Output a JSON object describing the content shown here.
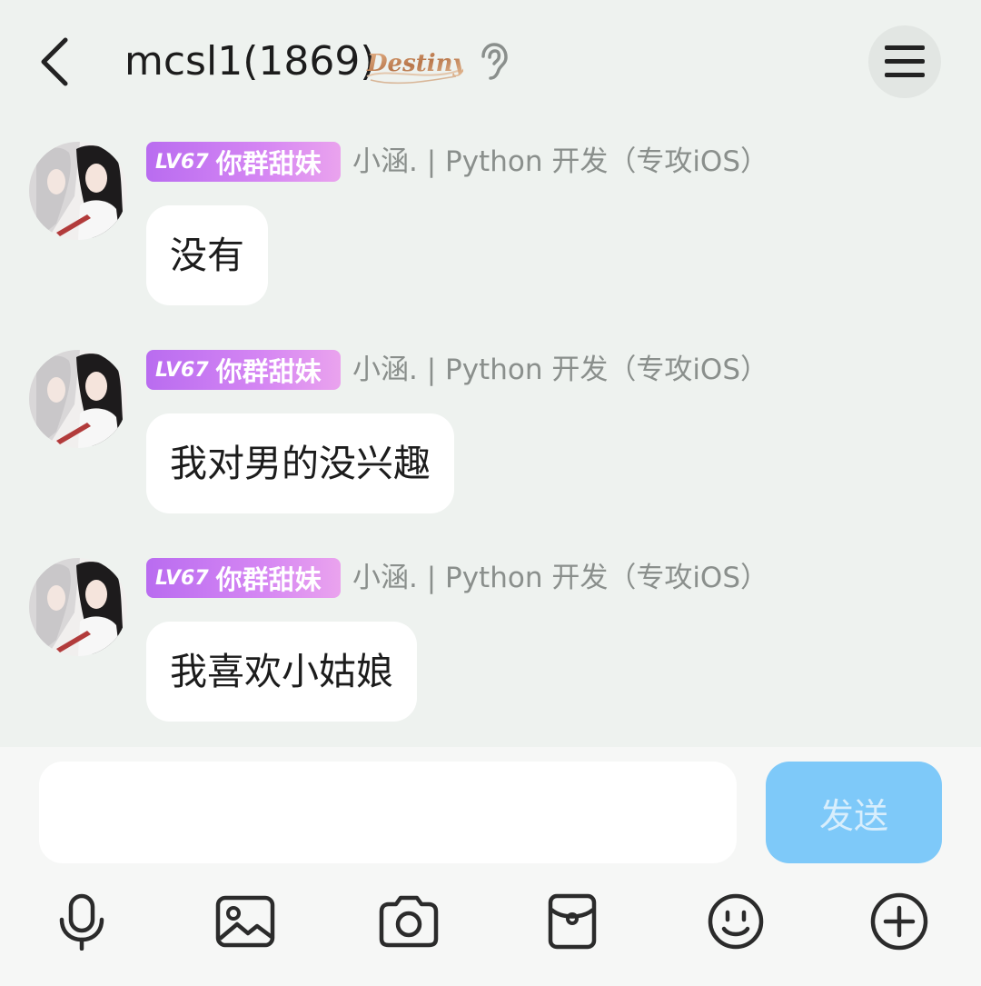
{
  "header": {
    "title": "mcsl1(1869)",
    "badge_text": "Destiny",
    "back_icon": "chevron-left-icon",
    "ear_icon": "ear-icon",
    "menu_icon": "hamburger-menu-icon"
  },
  "messages": [
    {
      "level": "LV67",
      "group_title": "你群甜妹",
      "sender": "小涵. | Python 开发（专攻iOS）",
      "text": "没有"
    },
    {
      "level": "LV67",
      "group_title": "你群甜妹",
      "sender": "小涵. | Python 开发（专攻iOS）",
      "text": "我对男的没兴趣"
    },
    {
      "level": "LV67",
      "group_title": "你群甜妹",
      "sender": "小涵. | Python 开发（专攻iOS）",
      "text": "我喜欢小姑娘"
    }
  ],
  "input": {
    "value": "",
    "placeholder": "",
    "send_label": "发送"
  },
  "toolbar": [
    {
      "icon": "microphone-icon"
    },
    {
      "icon": "image-icon"
    },
    {
      "icon": "camera-icon"
    },
    {
      "icon": "red-packet-icon"
    },
    {
      "icon": "emoji-icon"
    },
    {
      "icon": "plus-icon"
    }
  ],
  "colors": {
    "background": "#eef2ef",
    "bubble": "#ffffff",
    "level_badge_start": "#b96cf0",
    "level_badge_end": "#eaa3ee",
    "send_button": "#7ec9f9",
    "sender_name": "#8a8f8c"
  }
}
